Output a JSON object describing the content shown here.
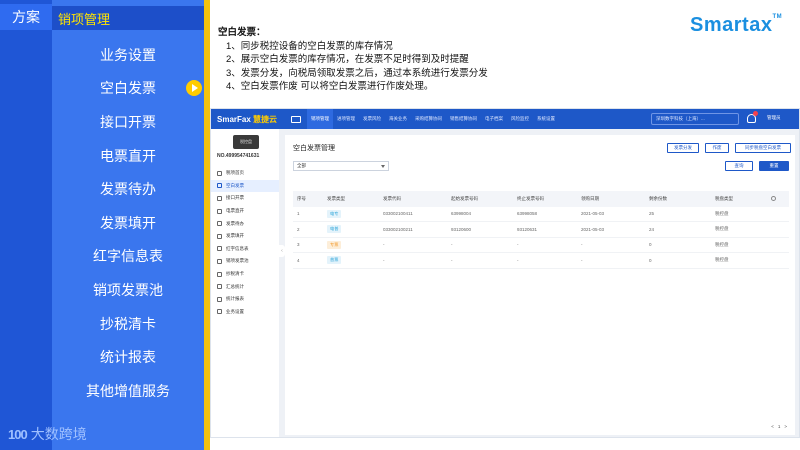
{
  "slide": {
    "scheme_tab": "方案",
    "menu_header": "销项管理",
    "menu_items": [
      {
        "label": "业务设置"
      },
      {
        "label": "空白发票"
      },
      {
        "label": "接口开票"
      },
      {
        "label": "电票直开"
      },
      {
        "label": "发票待办"
      },
      {
        "label": "发票填开"
      },
      {
        "label": "红字信息表"
      },
      {
        "label": "销项发票池"
      },
      {
        "label": "抄税清卡"
      },
      {
        "label": "统计报表"
      },
      {
        "label": "其他增值服务"
      }
    ],
    "active_item_index": 1,
    "bottom_brand_mark": "100",
    "bottom_brand": "大数跨境"
  },
  "description": {
    "title": "空白发票：",
    "lines": [
      "1、同步税控设备的空白发票的库存情况",
      "2、展示空白发票的库存情况，在发票不足时得到及时提醒",
      "3、发票分发，向税局领取发票之后，通过本系统进行发票分发",
      "4、空白发票作废 可以将空白发票进行作废处理。"
    ]
  },
  "logo": {
    "text": "Smartax",
    "tm": "TM"
  },
  "app": {
    "logo": "SmarFax",
    "logo_suffix": "慧捷云",
    "nav": [
      {
        "label": "销项管理",
        "active": true
      },
      {
        "label": "进项管理",
        "active": false
      },
      {
        "label": "发票风险",
        "active": false
      },
      {
        "label": "海关业务",
        "active": false
      },
      {
        "label": "采购结算协同",
        "active": false
      },
      {
        "label": "销售结算协同",
        "active": false
      },
      {
        "label": "电子档案",
        "active": false
      },
      {
        "label": "风险监控",
        "active": false
      },
      {
        "label": "系统设置",
        "active": false
      }
    ],
    "company": "深圳数字科技（上海）...",
    "user": "管理员",
    "device_label": "税控盘",
    "device_no": "NO.499954741631",
    "side_items": [
      {
        "label": "税项首页",
        "active": false
      },
      {
        "label": "空白发票",
        "active": true
      },
      {
        "label": "接口开票",
        "active": false
      },
      {
        "label": "电票直开",
        "active": false
      },
      {
        "label": "发票待办",
        "active": false
      },
      {
        "label": "发票填开",
        "active": false
      },
      {
        "label": "红字信息表",
        "active": false
      },
      {
        "label": "销项发票池",
        "active": false
      },
      {
        "label": "抄税清卡",
        "active": false
      },
      {
        "label": "汇总统计",
        "active": false
      },
      {
        "label": "统计报表",
        "active": false
      },
      {
        "label": "业务设置",
        "active": false
      }
    ],
    "page_title": "空白发票管理",
    "buttons": {
      "distribute": "发票分发",
      "void": "作废",
      "sync": "同步税盘空白发票",
      "query": "查询",
      "reset": "重置"
    },
    "filter_value": "全部",
    "table": {
      "headers": [
        "序号",
        "发票类型",
        "发票代码",
        "起始发票号码",
        "终止发票号码",
        "领购日期",
        "剩余份数",
        "税盘类型"
      ],
      "rows": [
        {
          "no": "1",
          "type": "电专",
          "type_color": "blue",
          "code": "033002100411",
          "start": "63998004",
          "end": "63998058",
          "date": "2021-05-03",
          "remain": "25",
          "tax": "税控盘"
        },
        {
          "no": "2",
          "type": "电普",
          "type_color": "blue",
          "code": "033002100211",
          "start": "93120600",
          "end": "93120631",
          "date": "2021-05-03",
          "remain": "24",
          "tax": "税控盘"
        },
        {
          "no": "3",
          "type": "专票",
          "type_color": "orange",
          "code": "-",
          "start": "-",
          "end": "-",
          "date": "-",
          "remain": "0",
          "tax": "税控盘"
        },
        {
          "no": "4",
          "type": "普票",
          "type_color": "blue",
          "code": "-",
          "start": "-",
          "end": "-",
          "date": "-",
          "remain": "0",
          "tax": "税控盘"
        }
      ]
    },
    "pager": {
      "prev": "<",
      "page": "1",
      "next": ">"
    }
  }
}
